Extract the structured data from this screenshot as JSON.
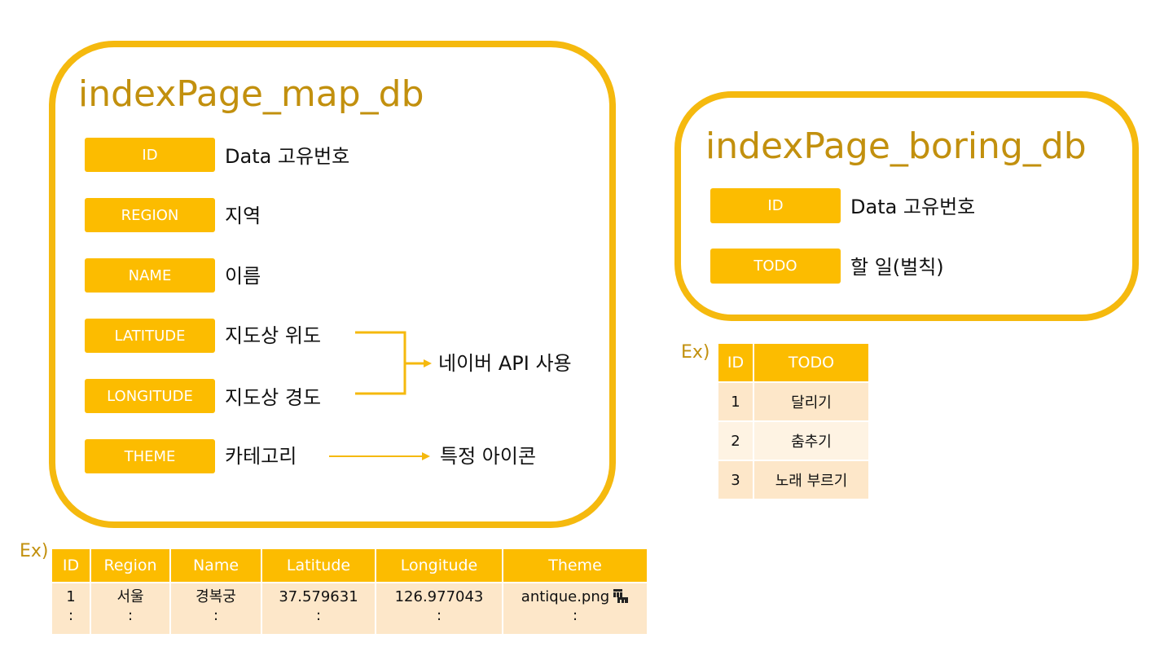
{
  "map_db": {
    "title": "indexPage_map_db",
    "fields": [
      {
        "label": "ID",
        "desc": "Data 고유번호"
      },
      {
        "label": "REGION",
        "desc": "지역"
      },
      {
        "label": "NAME",
        "desc": "이름"
      },
      {
        "label": "LATITUDE",
        "desc": "지도상 위도"
      },
      {
        "label": "LONGITUDE",
        "desc": "지도상 경도"
      },
      {
        "label": "THEME",
        "desc": "카테고리"
      }
    ],
    "coord_note": "네이버 API 사용",
    "theme_note": "특정 아이콘"
  },
  "boring_db": {
    "title": "indexPage_boring_db",
    "fields": [
      {
        "label": "ID",
        "desc": "Data 고유번호"
      },
      {
        "label": "TODO",
        "desc": "할 일(벌칙)"
      }
    ]
  },
  "map_example": {
    "ex_label": "Ex)",
    "headers": [
      "ID",
      "Region",
      "Name",
      "Latitude",
      "Longitude",
      "Theme"
    ],
    "row": [
      "1",
      "서울",
      "경복궁",
      "37.579631",
      "126.977043",
      "antique.png"
    ],
    "continuation": ":"
  },
  "boring_example": {
    "ex_label": "Ex)",
    "headers": [
      "ID",
      "TODO"
    ],
    "rows": [
      [
        "1",
        "달리기"
      ],
      [
        "2",
        "춤추기"
      ],
      [
        "3",
        "노래 부르기"
      ]
    ]
  },
  "colors": {
    "accent": "#FCBC00",
    "border": "#F5B90E",
    "title": "#C2900E",
    "row_light": "#FDE7C9",
    "row_lighter": "#FEF3E3"
  }
}
